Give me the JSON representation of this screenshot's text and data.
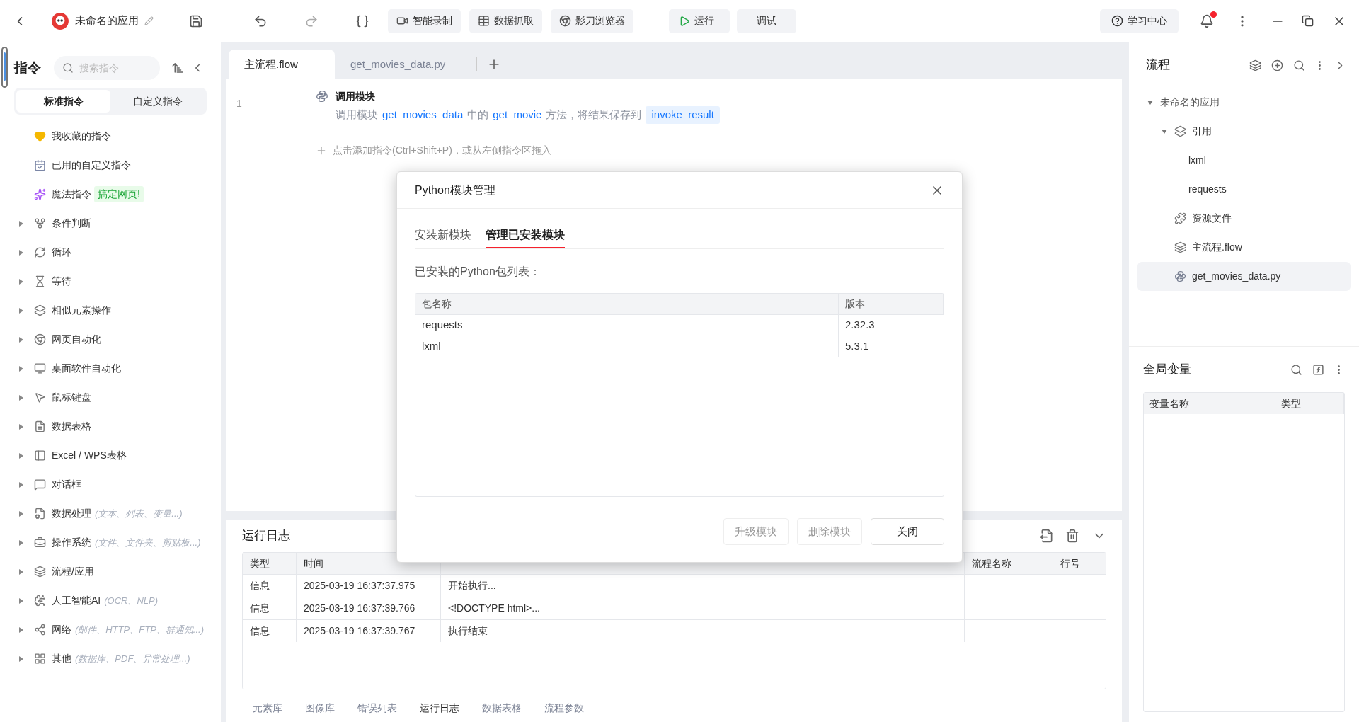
{
  "topbar": {
    "app_name": "未命名的应用",
    "tools": [
      {
        "label": "智能录制"
      },
      {
        "label": "数据抓取"
      },
      {
        "label": "影刀浏览器"
      }
    ],
    "run": "运行",
    "debug": "调试",
    "help": "学习中心",
    "has_notification": true
  },
  "sidebar": {
    "title": "指令",
    "search_placeholder": "搜索指令",
    "tabs": [
      {
        "label": "标准指令",
        "selected": true
      },
      {
        "label": "自定义指令",
        "selected": false
      }
    ],
    "items": [
      {
        "kind": "plain",
        "label": "我收藏的指令"
      },
      {
        "kind": "plain",
        "label": "已用的自定义指令"
      },
      {
        "kind": "plain",
        "label": "魔法指令",
        "badge": "搞定网页!"
      },
      {
        "kind": "group",
        "label": "条件判断"
      },
      {
        "kind": "group",
        "label": "循环"
      },
      {
        "kind": "group",
        "label": "等待"
      },
      {
        "kind": "group",
        "label": "相似元素操作"
      },
      {
        "kind": "group",
        "label": "网页自动化"
      },
      {
        "kind": "group",
        "label": "桌面软件自动化"
      },
      {
        "kind": "group",
        "label": "鼠标键盘"
      },
      {
        "kind": "group",
        "label": "数据表格"
      },
      {
        "kind": "group",
        "label": "Excel / WPS表格"
      },
      {
        "kind": "group",
        "label": "对话框"
      },
      {
        "kind": "group",
        "label": "数据处理",
        "hint": "(文本、列表、变量...)"
      },
      {
        "kind": "group",
        "label": "操作系统",
        "hint": "(文件、文件夹、剪贴板...)"
      },
      {
        "kind": "group",
        "label": "流程/应用"
      },
      {
        "kind": "group",
        "label": "人工智能AI",
        "hint": "(OCR、NLP)"
      },
      {
        "kind": "group",
        "label": "网络",
        "hint": "(邮件、HTTP、FTP、群通知...)"
      },
      {
        "kind": "group",
        "label": "其他",
        "hint": "(数据库、PDF、异常处理...)"
      }
    ]
  },
  "editor": {
    "tabs": [
      {
        "label": "主流程.flow",
        "selected": true
      },
      {
        "label": "get_movies_data.py",
        "selected": false
      }
    ],
    "lines": [
      {
        "number": "1",
        "title": "调用模块",
        "segments": [
          {
            "kind": "text",
            "text": "调用模块"
          },
          {
            "kind": "link",
            "text": "get_movies_data"
          },
          {
            "kind": "text",
            "text": "中的"
          },
          {
            "kind": "link",
            "text": "get_movie"
          },
          {
            "kind": "text",
            "text": "方法，将结果保存到"
          },
          {
            "kind": "var",
            "text": "invoke_result"
          }
        ]
      }
    ],
    "add_hint": "点击添加指令(Ctrl+Shift+P)，或从左侧指令区拖入"
  },
  "log": {
    "title": "运行日志",
    "columns": [
      "类型",
      "时间",
      "流程名称",
      "行号"
    ],
    "rows": [
      {
        "type": "信息",
        "time": "2025-03-19 16:37:37.975",
        "content": "开始执行..."
      },
      {
        "type": "信息",
        "time": "2025-03-19 16:37:39.766",
        "content": "<!DOCTYPE html>..."
      },
      {
        "type": "信息",
        "time": "2025-03-19 16:37:39.767",
        "content": "执行结束"
      }
    ]
  },
  "bottom_tabs": [
    {
      "label": "元素库",
      "selected": false
    },
    {
      "label": "图像库",
      "selected": false
    },
    {
      "label": "错误列表",
      "selected": false
    },
    {
      "label": "运行日志",
      "selected": true
    },
    {
      "label": "数据表格",
      "selected": false
    },
    {
      "label": "流程参数",
      "selected": false
    }
  ],
  "flow_panel": {
    "title": "流程",
    "tree": [
      {
        "label": "未命名的应用",
        "expanded": true,
        "selected": false,
        "children": [
          {
            "label": "引用",
            "expanded": true,
            "selected": false,
            "children": [
              {
                "label": "lxml",
                "selected": false
              },
              {
                "label": "requests",
                "selected": false
              }
            ]
          },
          {
            "label": "资源文件",
            "selected": false
          },
          {
            "label": "主流程.flow",
            "selected": false
          },
          {
            "label": "get_movies_data.py",
            "selected": true
          }
        ]
      }
    ]
  },
  "globals": {
    "title": "全局变量",
    "columns": [
      "变量名称",
      "类型"
    ]
  },
  "dialog": {
    "title": "Python模块管理",
    "tabs": [
      {
        "label": "安装新模块",
        "selected": false
      },
      {
        "label": "管理已安装模块",
        "selected": true
      }
    ],
    "caption": "已安装的Python包列表：",
    "columns": [
      "包名称",
      "版本"
    ],
    "rows": [
      {
        "name": "requests",
        "version": "2.32.3"
      },
      {
        "name": "lxml",
        "version": "5.3.1"
      }
    ],
    "buttons": [
      {
        "label": "升级模块",
        "kind": "secondary",
        "disabled": true
      },
      {
        "label": "删除模块",
        "kind": "secondary",
        "disabled": true
      },
      {
        "label": "关闭",
        "kind": "primary",
        "disabled": false
      }
    ]
  }
}
